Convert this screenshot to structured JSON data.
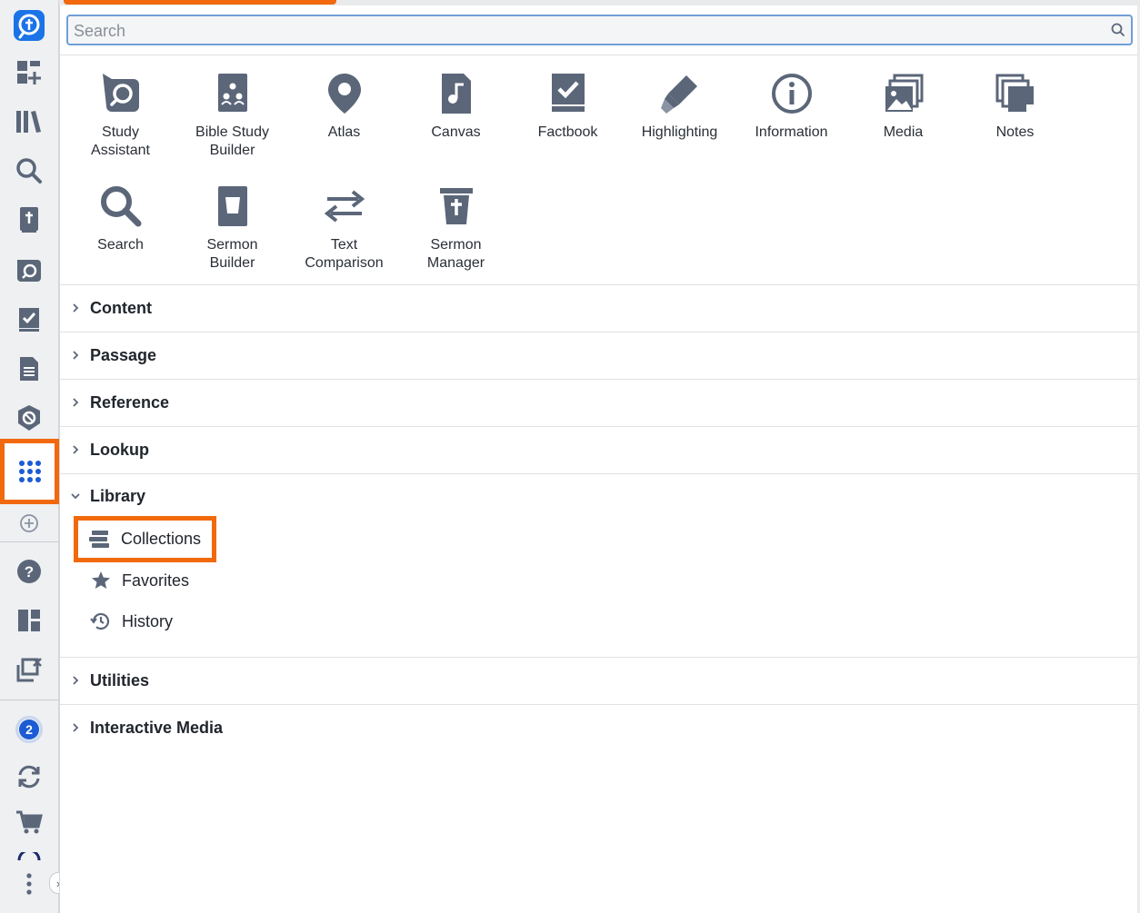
{
  "search": {
    "placeholder": "Search"
  },
  "tools": [
    {
      "label": "Study\nAssistant",
      "icon": "study-assistant-icon"
    },
    {
      "label": "Bible Study\nBuilder",
      "icon": "bible-study-builder-icon"
    },
    {
      "label": "Atlas",
      "icon": "atlas-pin-icon"
    },
    {
      "label": "Canvas",
      "icon": "canvas-icon"
    },
    {
      "label": "Factbook",
      "icon": "factbook-icon"
    },
    {
      "label": "Highlighting",
      "icon": "highlighter-icon"
    },
    {
      "label": "Information",
      "icon": "info-icon"
    },
    {
      "label": "Media",
      "icon": "media-icon"
    },
    {
      "label": "Notes",
      "icon": "notes-icon"
    },
    {
      "label": "Search",
      "icon": "search-icon"
    },
    {
      "label": "Sermon\nBuilder",
      "icon": "sermon-builder-icon"
    },
    {
      "label": "Text\nComparison",
      "icon": "text-comparison-icon"
    },
    {
      "label": "Sermon\nManager",
      "icon": "sermon-manager-icon"
    }
  ],
  "sections": {
    "content": "Content",
    "passage": "Passage",
    "reference": "Reference",
    "lookup": "Lookup",
    "library": "Library",
    "utilities": "Utilities",
    "interactive_media": "Interactive Media"
  },
  "library_items": {
    "collections": "Collections",
    "favorites": "Favorites",
    "history": "History"
  },
  "sidebar": {
    "notification_count": "2"
  },
  "colors": {
    "highlight": "#f2690d",
    "icon": "#5b6679",
    "brand": "#1b5bd3"
  }
}
